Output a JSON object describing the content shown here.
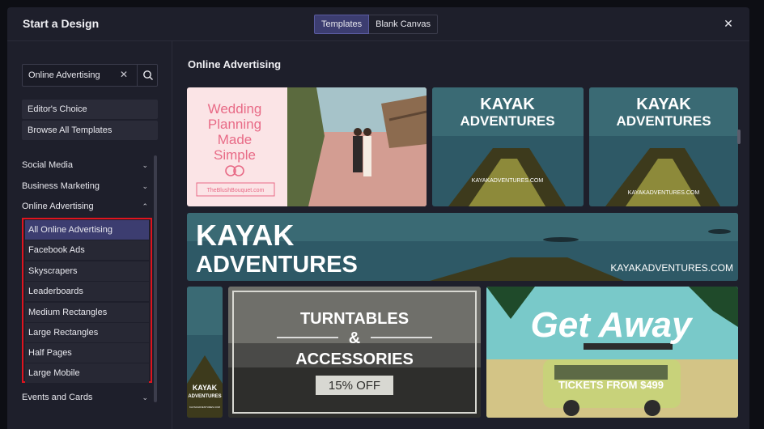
{
  "header": {
    "title": "Start a Design",
    "tabs": [
      {
        "label": "Templates",
        "active": true
      },
      {
        "label": "Blank Canvas",
        "active": false
      }
    ],
    "close_icon": "close-icon"
  },
  "sidebar": {
    "search": {
      "value": "Online Advertising",
      "clear_icon": "close-icon",
      "search_icon": "search-icon"
    },
    "pills": [
      {
        "label": "Editor's Choice"
      },
      {
        "label": "Browse All Templates"
      }
    ],
    "categories": [
      {
        "label": "Social Media",
        "expanded": false
      },
      {
        "label": "Business Marketing",
        "expanded": false
      },
      {
        "label": "Online Advertising",
        "expanded": true
      },
      {
        "label": "Events and Cards",
        "expanded": false
      }
    ],
    "subitems": [
      {
        "label": "All Online Advertising",
        "active": true
      },
      {
        "label": "Facebook Ads"
      },
      {
        "label": "Skyscrapers"
      },
      {
        "label": "Leaderboards"
      },
      {
        "label": "Medium Rectangles"
      },
      {
        "label": "Large Rectangles"
      },
      {
        "label": "Half Pages"
      },
      {
        "label": "Large Mobile"
      }
    ]
  },
  "main": {
    "title": "Online Advertising",
    "templates": {
      "wedding": {
        "line1": "Wedding",
        "line2": "Planning",
        "line3": "Made",
        "line4": "Simple",
        "url": "TheBlushBouquet.com"
      },
      "kayak": {
        "line1": "KAYAK",
        "line2": "ADVENTURES",
        "url": "KAYAKADVENTURES.COM"
      },
      "turntables": {
        "line1": "TURNTABLES",
        "line2": "&",
        "line3": "ACCESSORIES",
        "badge": "15% OFF"
      },
      "getaway": {
        "headline": "Get Away",
        "sub": "TICKETS FROM $499"
      }
    }
  },
  "colors": {
    "modal_bg": "#1e1f2b",
    "accent": "#3c3d70",
    "highlight_box": "#e0141e",
    "wedding_pink": "#e86a86",
    "kayak_teal": "#2e5966"
  }
}
